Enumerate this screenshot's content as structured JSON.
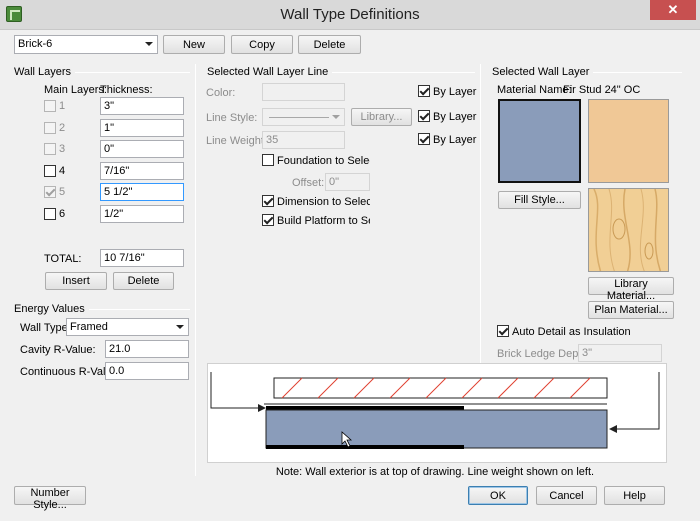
{
  "window": {
    "title": "Wall Type Definitions",
    "close_glyph": "✕"
  },
  "toolbar": {
    "wall_type_value": "Brick-6",
    "new_label": "New",
    "copy_label": "Copy",
    "delete_label": "Delete"
  },
  "wall_layers": {
    "title": "Wall Layers",
    "col_main": "Main Layers:",
    "col_thickness": "Thickness:",
    "layers": [
      {
        "num": "1",
        "thickness": "3\"",
        "main": false,
        "enabled": false
      },
      {
        "num": "2",
        "thickness": "1\"",
        "main": false,
        "enabled": false
      },
      {
        "num": "3",
        "thickness": "0\"",
        "main": false,
        "enabled": false
      },
      {
        "num": "4",
        "thickness": "7/16\"",
        "main": false,
        "enabled": true
      },
      {
        "num": "5",
        "thickness": "5 1/2\"",
        "main": true,
        "enabled": false
      },
      {
        "num": "6",
        "thickness": "1/2\"",
        "main": false,
        "enabled": true
      }
    ],
    "total_label": "TOTAL:",
    "total_value": "10 7/16\"",
    "insert_label": "Insert",
    "delete_label": "Delete"
  },
  "energy": {
    "title": "Energy Values",
    "wall_type_label": "Wall Type:",
    "wall_type_value": "Framed",
    "cavity_label": "Cavity R-Value:",
    "cavity_value": "21.0",
    "continuous_label": "Continuous R-Value:",
    "continuous_value": "0.0"
  },
  "line": {
    "title": "Selected Wall Layer Line",
    "color_label": "Color:",
    "style_label": "Line Style:",
    "library_label": "Library...",
    "weight_label": "Line Weight:",
    "weight_value": "35",
    "by_layer_label": "By Layer",
    "foundation_label": "Foundation to Selected",
    "offset_label": "Offset:",
    "offset_value": "0\"",
    "dimension_label": "Dimension to Selected L",
    "platform_label": "Build Platform to Select"
  },
  "layer": {
    "title": "Selected Wall Layer",
    "material_name_label": "Material Name:",
    "material_name_value": "Fir Stud 24\" OC",
    "fill_color": "#8a9cba",
    "material_color": "#f0c896",
    "fill_style_label": "Fill Style...",
    "library_material_label": "Library Material...",
    "plan_material_label": "Plan Material...",
    "auto_detail_label": "Auto Detail as Insulation",
    "brick_ledge_label": "Brick Ledge Depth:",
    "brick_ledge_value": "3\""
  },
  "preview": {
    "note": "Note: Wall exterior is at top of drawing. Line weight shown on left."
  },
  "footer": {
    "number_style_label": "Number Style...",
    "ok_label": "OK",
    "cancel_label": "Cancel",
    "help_label": "Help"
  }
}
